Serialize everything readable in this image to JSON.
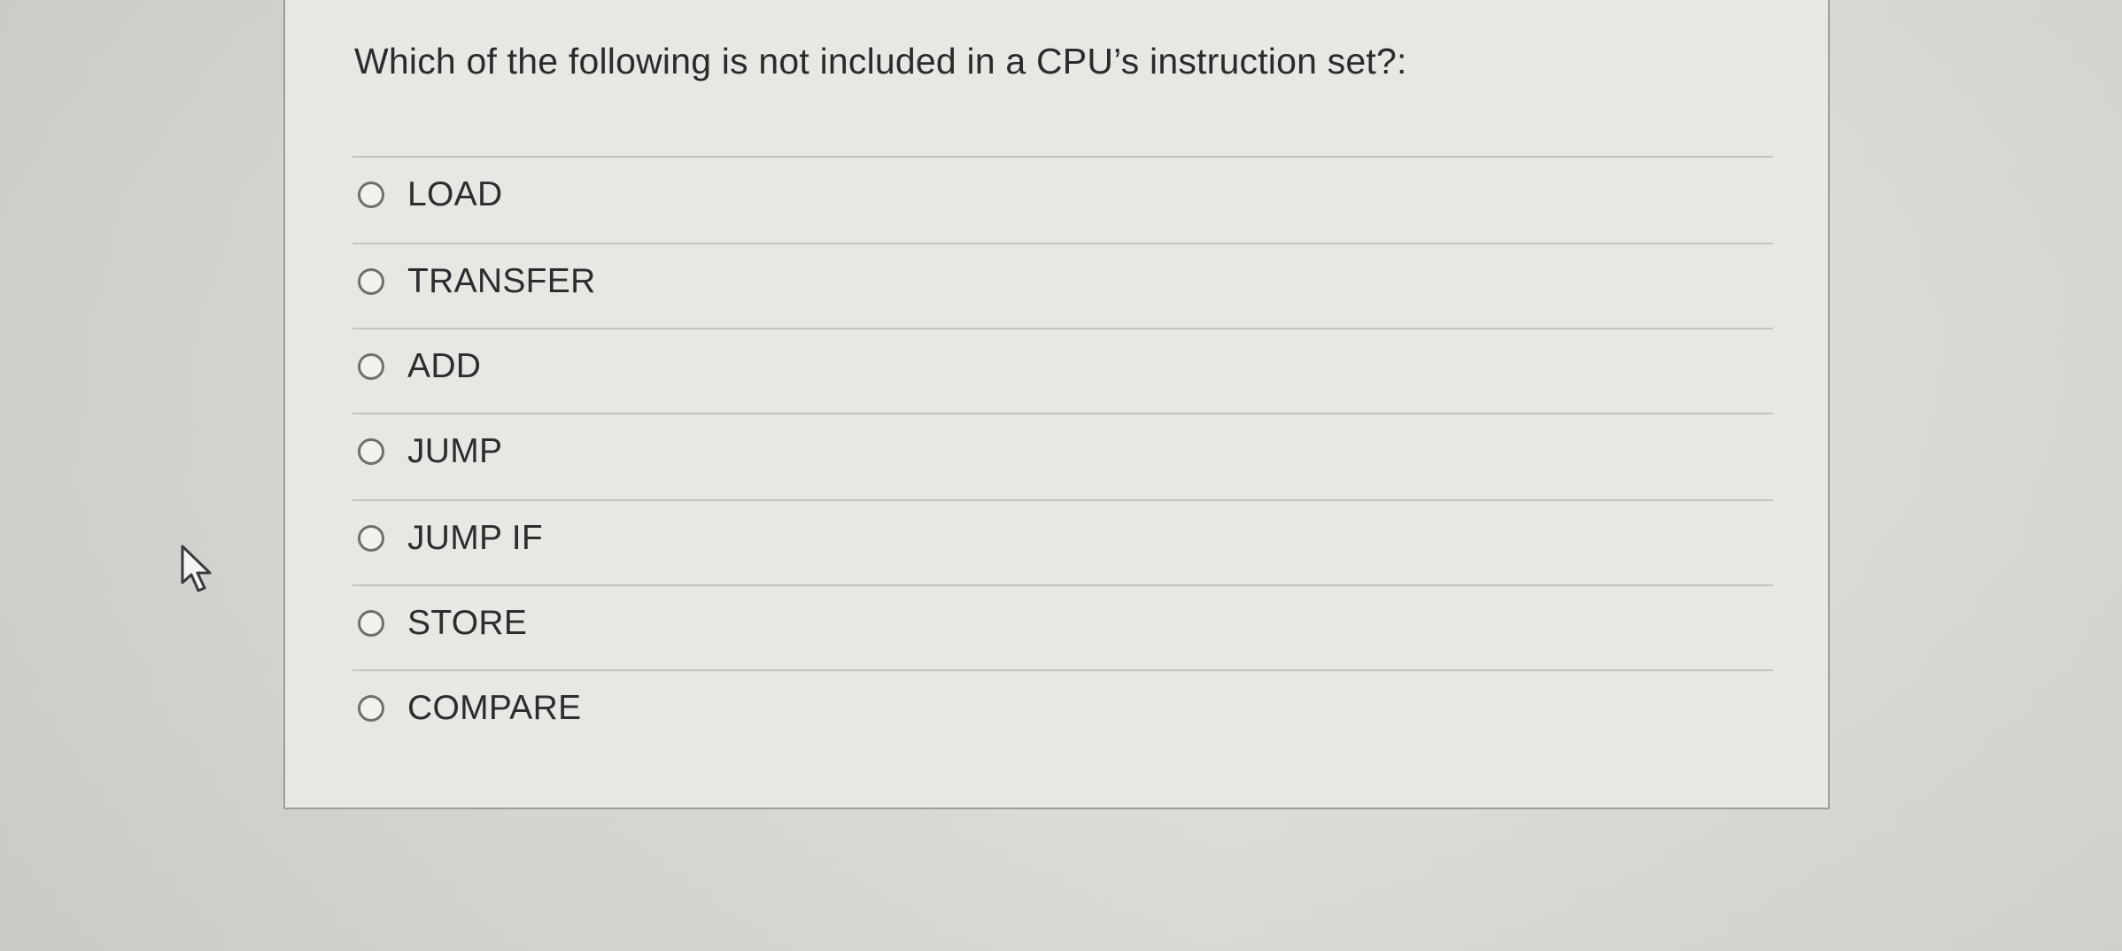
{
  "quiz": {
    "question": "Which of the following is not included in a CPU’s instruction set?:",
    "answers": [
      {
        "label": "LOAD"
      },
      {
        "label": "TRANSFER"
      },
      {
        "label": "ADD"
      },
      {
        "label": "JUMP"
      },
      {
        "label": "JUMP IF"
      },
      {
        "label": "STORE"
      },
      {
        "label": "COMPARE"
      }
    ]
  },
  "icons": {
    "radio": "radio-unselected-icon",
    "cursor": "mouse-pointer-icon"
  },
  "colors": {
    "background": "#dcdbd7",
    "card": "#e8e7e4",
    "text": "#2b2b2b",
    "border": "#9d9d9a"
  }
}
